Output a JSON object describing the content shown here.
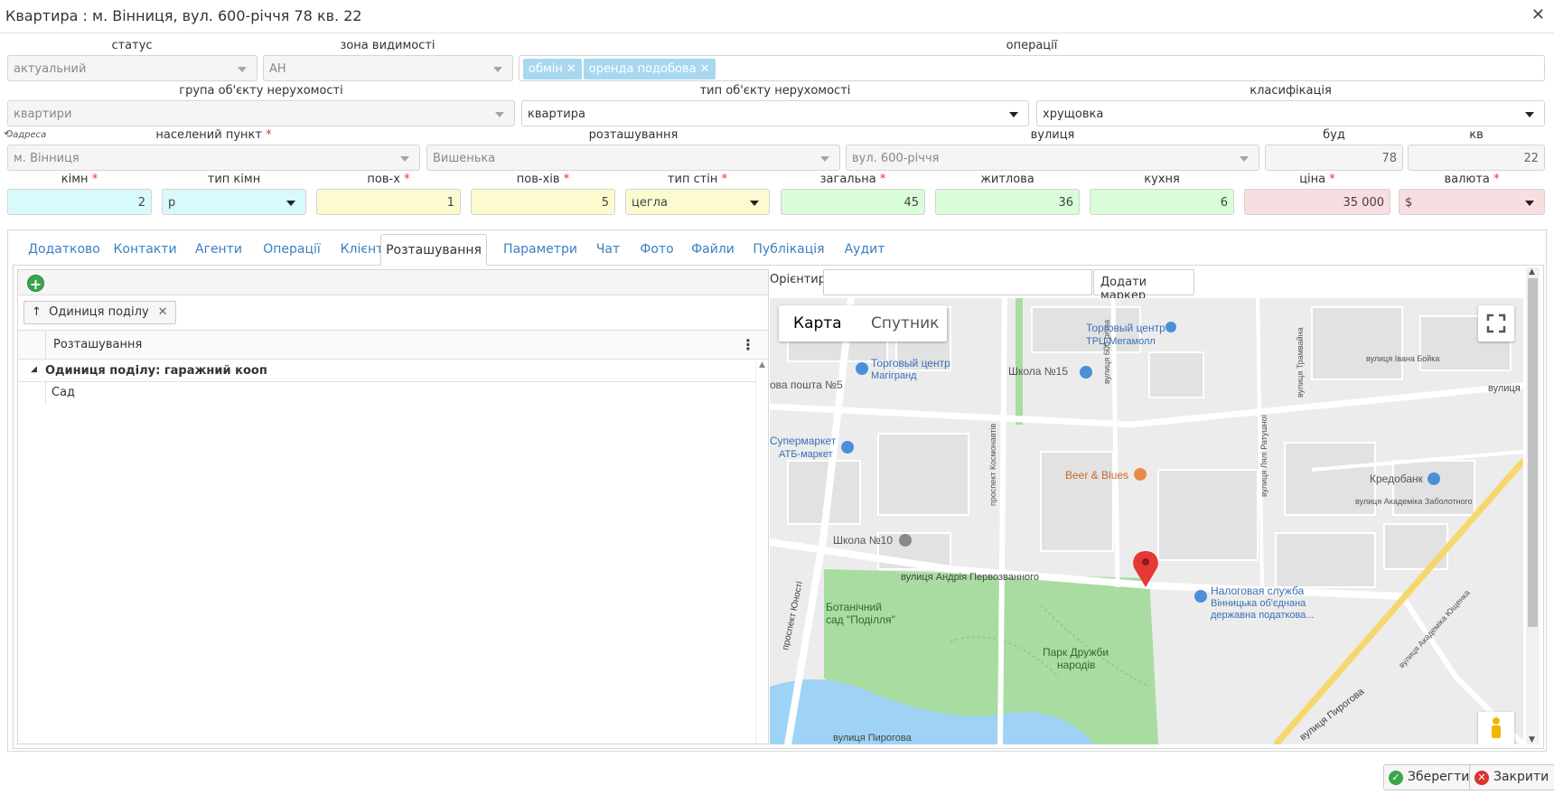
{
  "window": {
    "title": "Квартира : м. Вінниця, вул. 600-річчя 78 кв. 22",
    "close_glyph": "✕"
  },
  "form": {
    "row1": {
      "status_label": "статус",
      "status_value": "актуальний",
      "zone_label": "зона видимості",
      "zone_value": "АН",
      "ops_label": "операції",
      "ops_tags": [
        "обмін",
        "оренда подобова"
      ]
    },
    "row2": {
      "group_label": "група об'єкту нерухомості",
      "group_value": "квартири",
      "type_label": "тип об'єкту нерухомості",
      "type_value": "квартира",
      "class_label": "класифікація",
      "class_value": "хрущовка"
    },
    "row3": {
      "address_icon_label": "адреса",
      "city_label": "населений пункт",
      "city_value": "м. Вінниця",
      "location_label": "розташування",
      "location_value": "Вишенька",
      "street_label": "вулиця",
      "street_value": "вул. 600-річчя",
      "building_label": "буд",
      "building_value": "78",
      "apt_label": "кв",
      "apt_value": "22"
    },
    "row4": {
      "rooms_label": "кімн",
      "rooms_value": "2",
      "roomtype_label": "тип кімн",
      "roomtype_value": "р",
      "floor_label": "пов-х",
      "floor_value": "1",
      "floors_label": "пов-хів",
      "floors_value": "5",
      "walls_label": "тип стін",
      "walls_value": "цегла",
      "total_label": "загальна",
      "total_value": "45",
      "living_label": "житлова",
      "living_value": "36",
      "kitchen_label": "кухня",
      "kitchen_value": "6",
      "price_label": "ціна",
      "price_value": "35 000",
      "currency_label": "валюта",
      "currency_value": "$"
    },
    "required_mark": "*"
  },
  "tabs": [
    "Додатково",
    "Контакти",
    "Агенти",
    "Операції",
    "Клієнти",
    "Розташування",
    "Параметри",
    "Чат",
    "Фото",
    "Файли",
    "Публікація",
    "Аудит"
  ],
  "active_tab": "Розташування",
  "grid": {
    "add_glyph": "+",
    "group_chip": "Одиниця поділу",
    "group_arrow": "↑",
    "chip_close": "✕",
    "column": "Розташування",
    "menu_glyph": "⋮",
    "group_row": "Одиниця поділу: гаражний кооп",
    "rows": [
      "Сад"
    ]
  },
  "orient": {
    "label": "Орієнтир",
    "add_marker": "Додати маркер"
  },
  "map": {
    "type_map": "Карта",
    "type_sat": "Спутник",
    "labels": [
      "Торговый центр",
      "ТРЦ Мегамолл",
      "Торговый центр",
      "Магігранд",
      "Школа №15",
      "ова пошта №5",
      "Супермаркет",
      "АТБ-маркет",
      "Beer & Blues",
      "Кредобанк",
      "Школа №10",
      "вулиця Андрія Первозванного",
      "Ботанічний",
      "сад \"Поділля\"",
      "Парк Дружби",
      "народів",
      "Налоговая служба",
      "Вінницька об'єднана",
      "державна податкова...",
      "вулиця Пирогова",
      "вулиця",
      "проспект Юності",
      "вулиця Івана Бойка",
      "вулиця Академіка Заболотного",
      "вулиця 600-річча",
      "проспект Космонавтів",
      "вулиця Пирогова",
      "вулиця Лялі Ратушної",
      "вулиця Трамвайна",
      "вулиця Академіка Ющенка"
    ],
    "road_color": "#ffffff",
    "park_color": "#a8dca0",
    "water_color": "#9fd3f5",
    "marker_color": "#e53935",
    "highway_color": "#f5d76e"
  },
  "footer": {
    "save": "Зберегти",
    "close": "Закрити"
  }
}
